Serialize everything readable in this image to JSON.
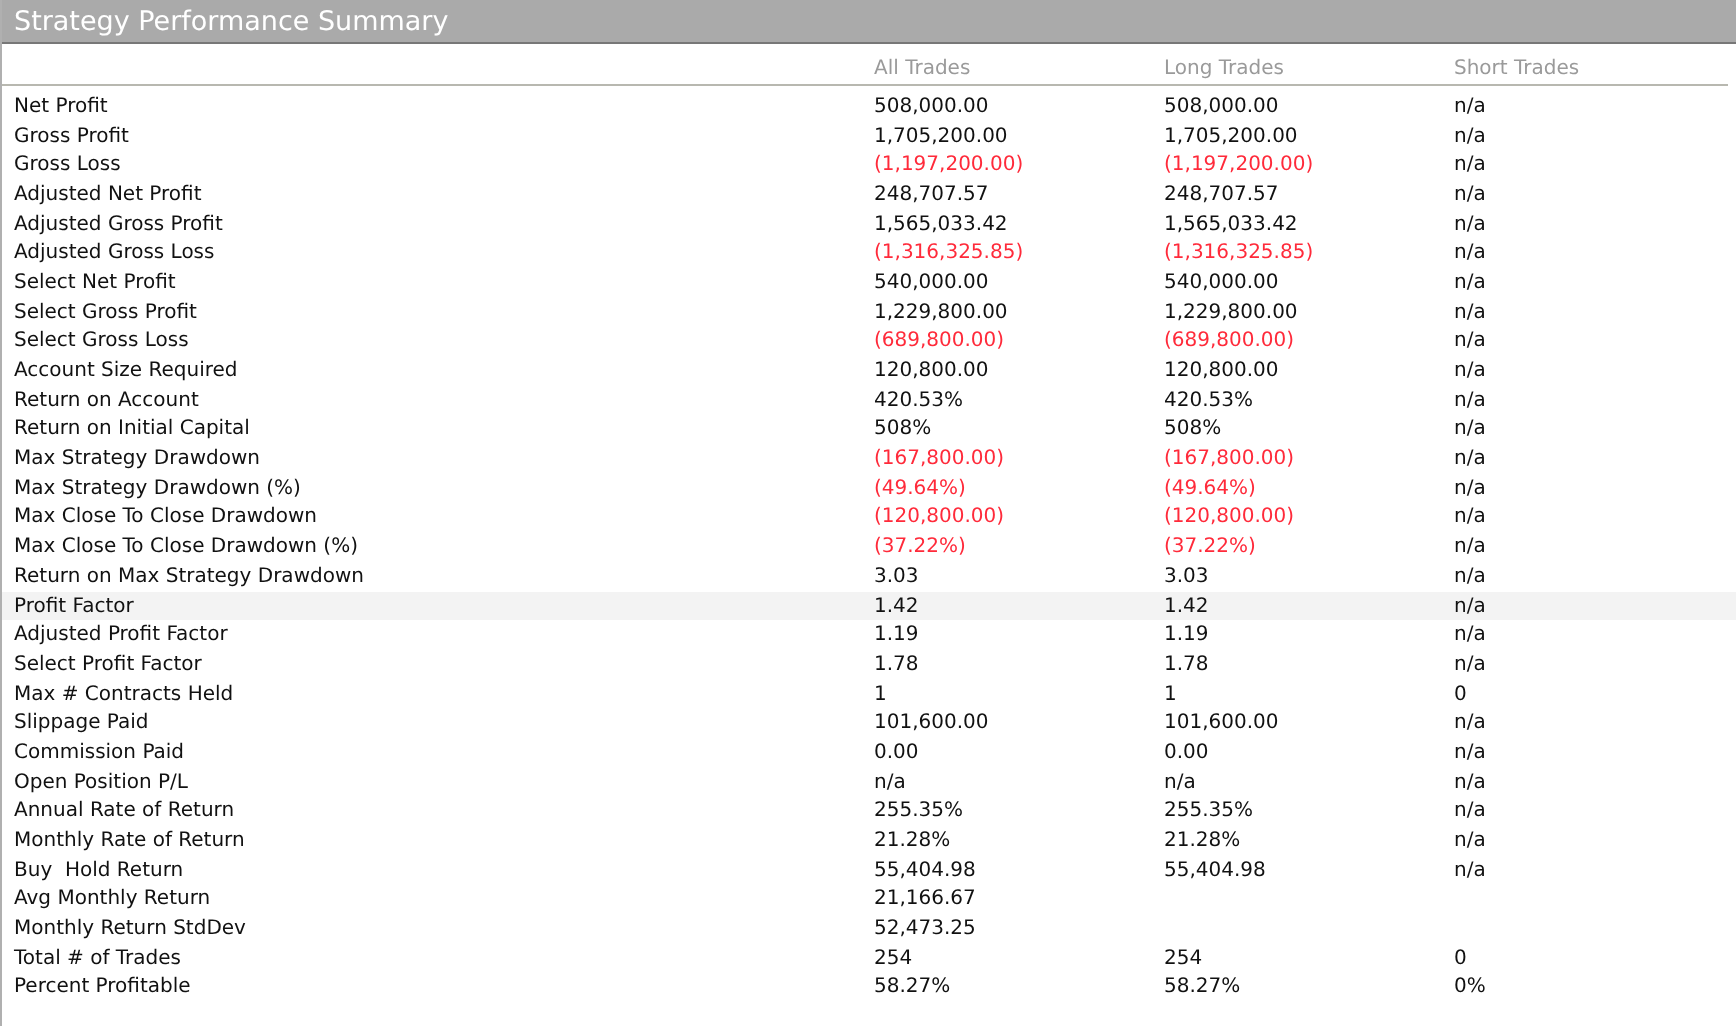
{
  "panel": {
    "title": "Strategy Performance Summary"
  },
  "columns": [
    "All Trades",
    "Long Trades",
    "Short Trades"
  ],
  "rows": [
    {
      "label": "Net Profit",
      "highlighted": false,
      "cells": [
        {
          "text": "508,000.00",
          "negative": false
        },
        {
          "text": "508,000.00",
          "negative": false
        },
        {
          "text": "n/a",
          "negative": false
        }
      ]
    },
    {
      "label": "Gross Profit",
      "highlighted": false,
      "cells": [
        {
          "text": "1,705,200.00",
          "negative": false
        },
        {
          "text": "1,705,200.00",
          "negative": false
        },
        {
          "text": "n/a",
          "negative": false
        }
      ]
    },
    {
      "label": "Gross Loss",
      "highlighted": false,
      "cells": [
        {
          "text": "(1,197,200.00)",
          "negative": true
        },
        {
          "text": "(1,197,200.00)",
          "negative": true
        },
        {
          "text": "n/a",
          "negative": false
        }
      ]
    },
    {
      "label": "Adjusted Net Profit",
      "highlighted": false,
      "cells": [
        {
          "text": "248,707.57",
          "negative": false
        },
        {
          "text": "248,707.57",
          "negative": false
        },
        {
          "text": "n/a",
          "negative": false
        }
      ]
    },
    {
      "label": "Adjusted Gross Profit",
      "highlighted": false,
      "cells": [
        {
          "text": "1,565,033.42",
          "negative": false
        },
        {
          "text": "1,565,033.42",
          "negative": false
        },
        {
          "text": "n/a",
          "negative": false
        }
      ]
    },
    {
      "label": "Adjusted Gross Loss",
      "highlighted": false,
      "cells": [
        {
          "text": "(1,316,325.85)",
          "negative": true
        },
        {
          "text": "(1,316,325.85)",
          "negative": true
        },
        {
          "text": "n/a",
          "negative": false
        }
      ]
    },
    {
      "label": "Select Net Profit",
      "highlighted": false,
      "cells": [
        {
          "text": "540,000.00",
          "negative": false
        },
        {
          "text": "540,000.00",
          "negative": false
        },
        {
          "text": "n/a",
          "negative": false
        }
      ]
    },
    {
      "label": "Select Gross Profit",
      "highlighted": false,
      "cells": [
        {
          "text": "1,229,800.00",
          "negative": false
        },
        {
          "text": "1,229,800.00",
          "negative": false
        },
        {
          "text": "n/a",
          "negative": false
        }
      ]
    },
    {
      "label": "Select Gross Loss",
      "highlighted": false,
      "cells": [
        {
          "text": "(689,800.00)",
          "negative": true
        },
        {
          "text": "(689,800.00)",
          "negative": true
        },
        {
          "text": "n/a",
          "negative": false
        }
      ]
    },
    {
      "label": "Account Size Required",
      "highlighted": false,
      "cells": [
        {
          "text": "120,800.00",
          "negative": false
        },
        {
          "text": "120,800.00",
          "negative": false
        },
        {
          "text": "n/a",
          "negative": false
        }
      ]
    },
    {
      "label": "Return on Account",
      "highlighted": false,
      "cells": [
        {
          "text": "420.53%",
          "negative": false
        },
        {
          "text": "420.53%",
          "negative": false
        },
        {
          "text": "n/a",
          "negative": false
        }
      ]
    },
    {
      "label": "Return on Initial Capital",
      "highlighted": false,
      "cells": [
        {
          "text": "508%",
          "negative": false
        },
        {
          "text": "508%",
          "negative": false
        },
        {
          "text": "n/a",
          "negative": false
        }
      ]
    },
    {
      "label": "Max Strategy Drawdown",
      "highlighted": false,
      "cells": [
        {
          "text": "(167,800.00)",
          "negative": true
        },
        {
          "text": "(167,800.00)",
          "negative": true
        },
        {
          "text": "n/a",
          "negative": false
        }
      ]
    },
    {
      "label": "Max Strategy Drawdown (%)",
      "highlighted": false,
      "cells": [
        {
          "text": "(49.64%)",
          "negative": true
        },
        {
          "text": "(49.64%)",
          "negative": true
        },
        {
          "text": "n/a",
          "negative": false
        }
      ]
    },
    {
      "label": "Max Close To Close Drawdown",
      "highlighted": false,
      "cells": [
        {
          "text": "(120,800.00)",
          "negative": true
        },
        {
          "text": "(120,800.00)",
          "negative": true
        },
        {
          "text": "n/a",
          "negative": false
        }
      ]
    },
    {
      "label": "Max Close To Close Drawdown (%)",
      "highlighted": false,
      "cells": [
        {
          "text": "(37.22%)",
          "negative": true
        },
        {
          "text": "(37.22%)",
          "negative": true
        },
        {
          "text": "n/a",
          "negative": false
        }
      ]
    },
    {
      "label": "Return on Max Strategy Drawdown",
      "highlighted": false,
      "cells": [
        {
          "text": "3.03",
          "negative": false
        },
        {
          "text": "3.03",
          "negative": false
        },
        {
          "text": "n/a",
          "negative": false
        }
      ]
    },
    {
      "label": "Profit Factor",
      "highlighted": true,
      "cells": [
        {
          "text": "1.42",
          "negative": false
        },
        {
          "text": "1.42",
          "negative": false
        },
        {
          "text": "n/a",
          "negative": false
        }
      ]
    },
    {
      "label": "Adjusted Profit Factor",
      "highlighted": false,
      "cells": [
        {
          "text": "1.19",
          "negative": false
        },
        {
          "text": "1.19",
          "negative": false
        },
        {
          "text": "n/a",
          "negative": false
        }
      ]
    },
    {
      "label": "Select Profit Factor",
      "highlighted": false,
      "cells": [
        {
          "text": "1.78",
          "negative": false
        },
        {
          "text": "1.78",
          "negative": false
        },
        {
          "text": "n/a",
          "negative": false
        }
      ]
    },
    {
      "label": "Max # Contracts Held",
      "highlighted": false,
      "cells": [
        {
          "text": "1",
          "negative": false
        },
        {
          "text": "1",
          "negative": false
        },
        {
          "text": "0",
          "negative": false
        }
      ]
    },
    {
      "label": "Slippage Paid",
      "highlighted": false,
      "cells": [
        {
          "text": "101,600.00",
          "negative": false
        },
        {
          "text": "101,600.00",
          "negative": false
        },
        {
          "text": "n/a",
          "negative": false
        }
      ]
    },
    {
      "label": "Commission Paid",
      "highlighted": false,
      "cells": [
        {
          "text": "0.00",
          "negative": false
        },
        {
          "text": "0.00",
          "negative": false
        },
        {
          "text": "n/a",
          "negative": false
        }
      ]
    },
    {
      "label": "Open Position P/L",
      "highlighted": false,
      "cells": [
        {
          "text": "n/a",
          "negative": false
        },
        {
          "text": "n/a",
          "negative": false
        },
        {
          "text": "n/a",
          "negative": false
        }
      ]
    },
    {
      "label": "Annual Rate of Return",
      "highlighted": false,
      "cells": [
        {
          "text": "255.35%",
          "negative": false
        },
        {
          "text": "255.35%",
          "negative": false
        },
        {
          "text": "n/a",
          "negative": false
        }
      ]
    },
    {
      "label": "Monthly Rate of Return",
      "highlighted": false,
      "cells": [
        {
          "text": "21.28%",
          "negative": false
        },
        {
          "text": "21.28%",
          "negative": false
        },
        {
          "text": "n/a",
          "negative": false
        }
      ]
    },
    {
      "label": "Buy  Hold Return",
      "highlighted": false,
      "cells": [
        {
          "text": "55,404.98",
          "negative": false
        },
        {
          "text": "55,404.98",
          "negative": false
        },
        {
          "text": "n/a",
          "negative": false
        }
      ]
    },
    {
      "label": "Avg Monthly Return",
      "highlighted": false,
      "cells": [
        {
          "text": "21,166.67",
          "negative": false
        }
      ]
    },
    {
      "label": "Monthly Return StdDev",
      "highlighted": false,
      "cells": [
        {
          "text": "52,473.25",
          "negative": false
        }
      ]
    },
    {
      "label": "Total # of Trades",
      "highlighted": false,
      "cells": [
        {
          "text": "254",
          "negative": false
        },
        {
          "text": "254",
          "negative": false
        },
        {
          "text": "0",
          "negative": false
        }
      ]
    },
    {
      "label": "Percent Profitable",
      "highlighted": false,
      "cells": [
        {
          "text": "58.27%",
          "negative": false
        },
        {
          "text": "58.27%",
          "negative": false
        },
        {
          "text": "0%",
          "negative": false
        }
      ]
    }
  ]
}
